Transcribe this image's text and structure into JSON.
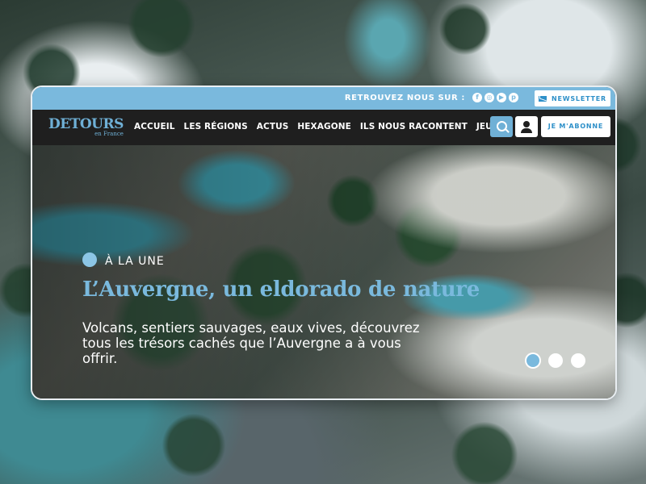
{
  "topbar": {
    "follow_label": "RETROUVEZ NOUS SUR :",
    "socials": [
      {
        "icon": "facebook-icon",
        "glyph": "f"
      },
      {
        "icon": "instagram-icon",
        "glyph": "◎"
      },
      {
        "icon": "youtube-icon",
        "glyph": "▶"
      },
      {
        "icon": "pinterest-icon",
        "glyph": "p"
      }
    ],
    "newsletter_label": "NEWSLETTER"
  },
  "nav": {
    "logo_main": "DETOURS",
    "logo_sub": "en France",
    "items": [
      "ACCUEIL",
      "LES RÉGIONS",
      "ACTUS",
      "HEXAGONE",
      "ILS NOUS RACONTENT",
      "JEUX"
    ],
    "subscribe_label": "JE M'ABONNE"
  },
  "hero": {
    "kicker": "À LA UNE",
    "title": "L’Auvergne, un eldorado de nature",
    "excerpt": "Volcans, sentiers sauvages, eaux vives, découvrez tous les trésors cachés que l’Auvergne a à vous offrir.",
    "slides_total": 3,
    "active_slide": 1
  },
  "colors": {
    "accent": "#7ab9dd",
    "navbar": "#1f1f1f",
    "link_blue": "#2e90c9"
  }
}
